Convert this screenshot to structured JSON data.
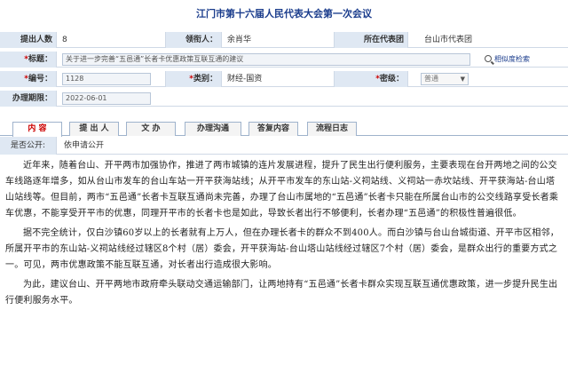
{
  "page": {
    "title": "江门市第十六届人民代表大会第一次会议"
  },
  "form": {
    "proposer_count_label": "提出人数",
    "proposer_count": "8",
    "leader_label": "领衔人：",
    "leader": "余肖华",
    "delegation_label": "所在代表团",
    "delegation": "台山市代表团",
    "title_label": "标题：",
    "title_value": "关于进一步完善“五邑通”长者卡优惠政策互联互通的建议",
    "similar_search_label": "相似度检索",
    "number_label": "编号：",
    "number_value": "1128",
    "category_label": "类别：",
    "category_value": "财经-国资",
    "secrecy_label": "密级：",
    "secrecy_value": "普通",
    "deadline_label": "办理期限：",
    "deadline_value": "2022-06-01",
    "required_mark": "*"
  },
  "tabs": [
    {
      "label": "内 容",
      "active": true
    },
    {
      "label": "提 出 人",
      "active": false
    },
    {
      "label": "文 办",
      "active": false
    },
    {
      "label": "办理沟通",
      "active": false
    },
    {
      "label": "答复内容",
      "active": false
    },
    {
      "label": "流程日志",
      "active": false
    }
  ],
  "publicity": {
    "label": "是否公开:",
    "value": "依申请公开"
  },
  "content": {
    "paragraphs": [
      "近年来，随着台山、开平两市加强协作，推进了两市城镇的连片发展进程，提升了民生出行便利服务，主要表现在台开两地之间的公交车线路逐年增多，如从台山市发车的台山车站一开平获海站线；从开平市发车的东山站-义祠站线、义祠站一赤坎站线、开平获海站-台山塔山站线等。但目前，两市“五邑通”长者卡互联互通尚未完善，办理了台山市属地的“五邑通”长者卡只能在所属台山市的公交线路享受长者乘车优惠，不能享受开平市的优惠，同理开平市的长者卡也是如此，导致长者出行不够便利，长者办理“五邑通”的积极性普遍很低。",
      "据不完全统计，仅白沙镇60岁以上的长者就有上万人，但在办理长者卡的群众不到400人。而白沙镇与台山台城街道、开平市区相邻，所属开平市的东山站-义祠站线经过辖区8个村（居）委会，开平获海站-台山塔山站线经过辖区7个村（居）委会，是群众出行的重要方式之一。可见，两市优惠政策不能互联互通，对长者出行造成很大影响。",
      "为此，建议台山、开平两地市政府牵头联动交通运输部门，让两地持有“五邑通”长者卡群众实现互联互通优惠政策，进一步提升民生出行便利服务水平。"
    ]
  }
}
